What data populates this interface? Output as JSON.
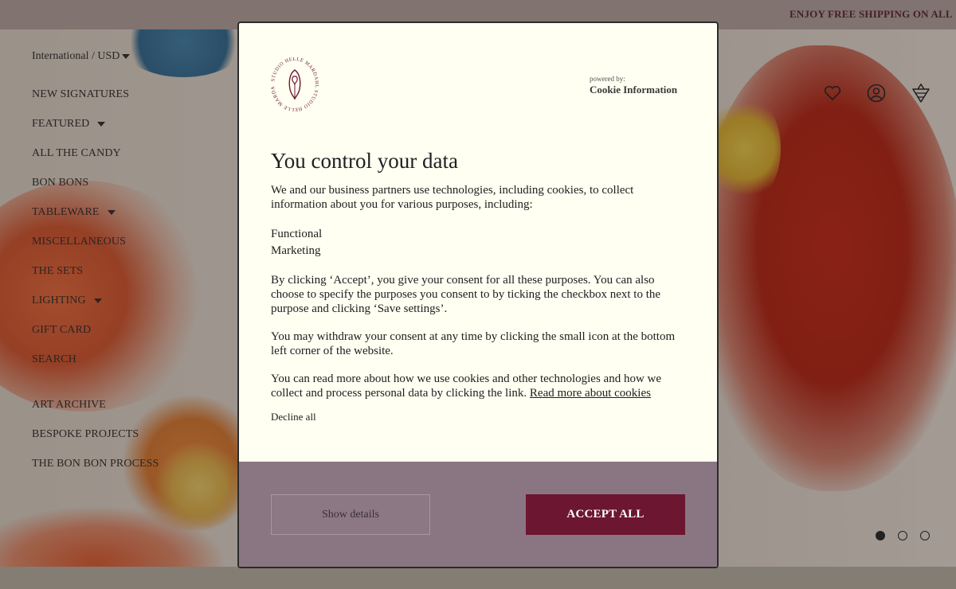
{
  "topbar": {
    "announcement": "ENJOY FREE SHIPPING ON ALL"
  },
  "locale": {
    "label": "International / USD"
  },
  "nav": {
    "items": [
      {
        "label": "NEW SIGNATURES"
      },
      {
        "label": "FEATURED"
      },
      {
        "label": "ALL THE CANDY"
      },
      {
        "label": "BON BONS"
      },
      {
        "label": "TABLEWARE"
      },
      {
        "label": "MISCELLANEOUS"
      },
      {
        "label": "THE SETS"
      },
      {
        "label": "LIGHTING"
      },
      {
        "label": "GIFT CARD"
      },
      {
        "label": "SEARCH"
      }
    ],
    "secondary": [
      {
        "label": "ART ARCHIVE"
      },
      {
        "label": "BESPOKE PROJECTS"
      },
      {
        "label": "THE BON BON PROCESS"
      }
    ]
  },
  "header_icons": [
    "heart-icon",
    "account-icon",
    "cart-icon"
  ],
  "slider": {
    "slide_count": 3,
    "active_slide": 1
  },
  "modal": {
    "brand_logo_text": "STUDIO HELLE MARDAHL",
    "powered_by": "powered by:",
    "powered_name": "Cookie Information",
    "title": "You control your data",
    "intro": "We and our business partners use technologies, including cookies, to collect information about you for various purposes, including:",
    "purposes": [
      "Functional",
      "Marketing"
    ],
    "consent_text": "By clicking ‘Accept’, you give your consent for all these purposes. You can also choose to specify the purposes you consent to by ticking the checkbox next to the purpose and clicking ‘Save settings’.",
    "withdraw_text": "You may withdraw your consent at any time by clicking the small icon at the bottom left corner of the website.",
    "readmore_text": "You can read more about how we use cookies and other technologies and how we collect and process personal data by clicking the link.",
    "readmore_link": "Read more about cookies",
    "decline_label": "Decline all",
    "show_details_label": "Show details",
    "accept_label": "ACCEPT ALL"
  },
  "colors": {
    "accent": "#6d1631",
    "footer_panel": "#8a7682",
    "modal_bg": "#fffff2"
  }
}
